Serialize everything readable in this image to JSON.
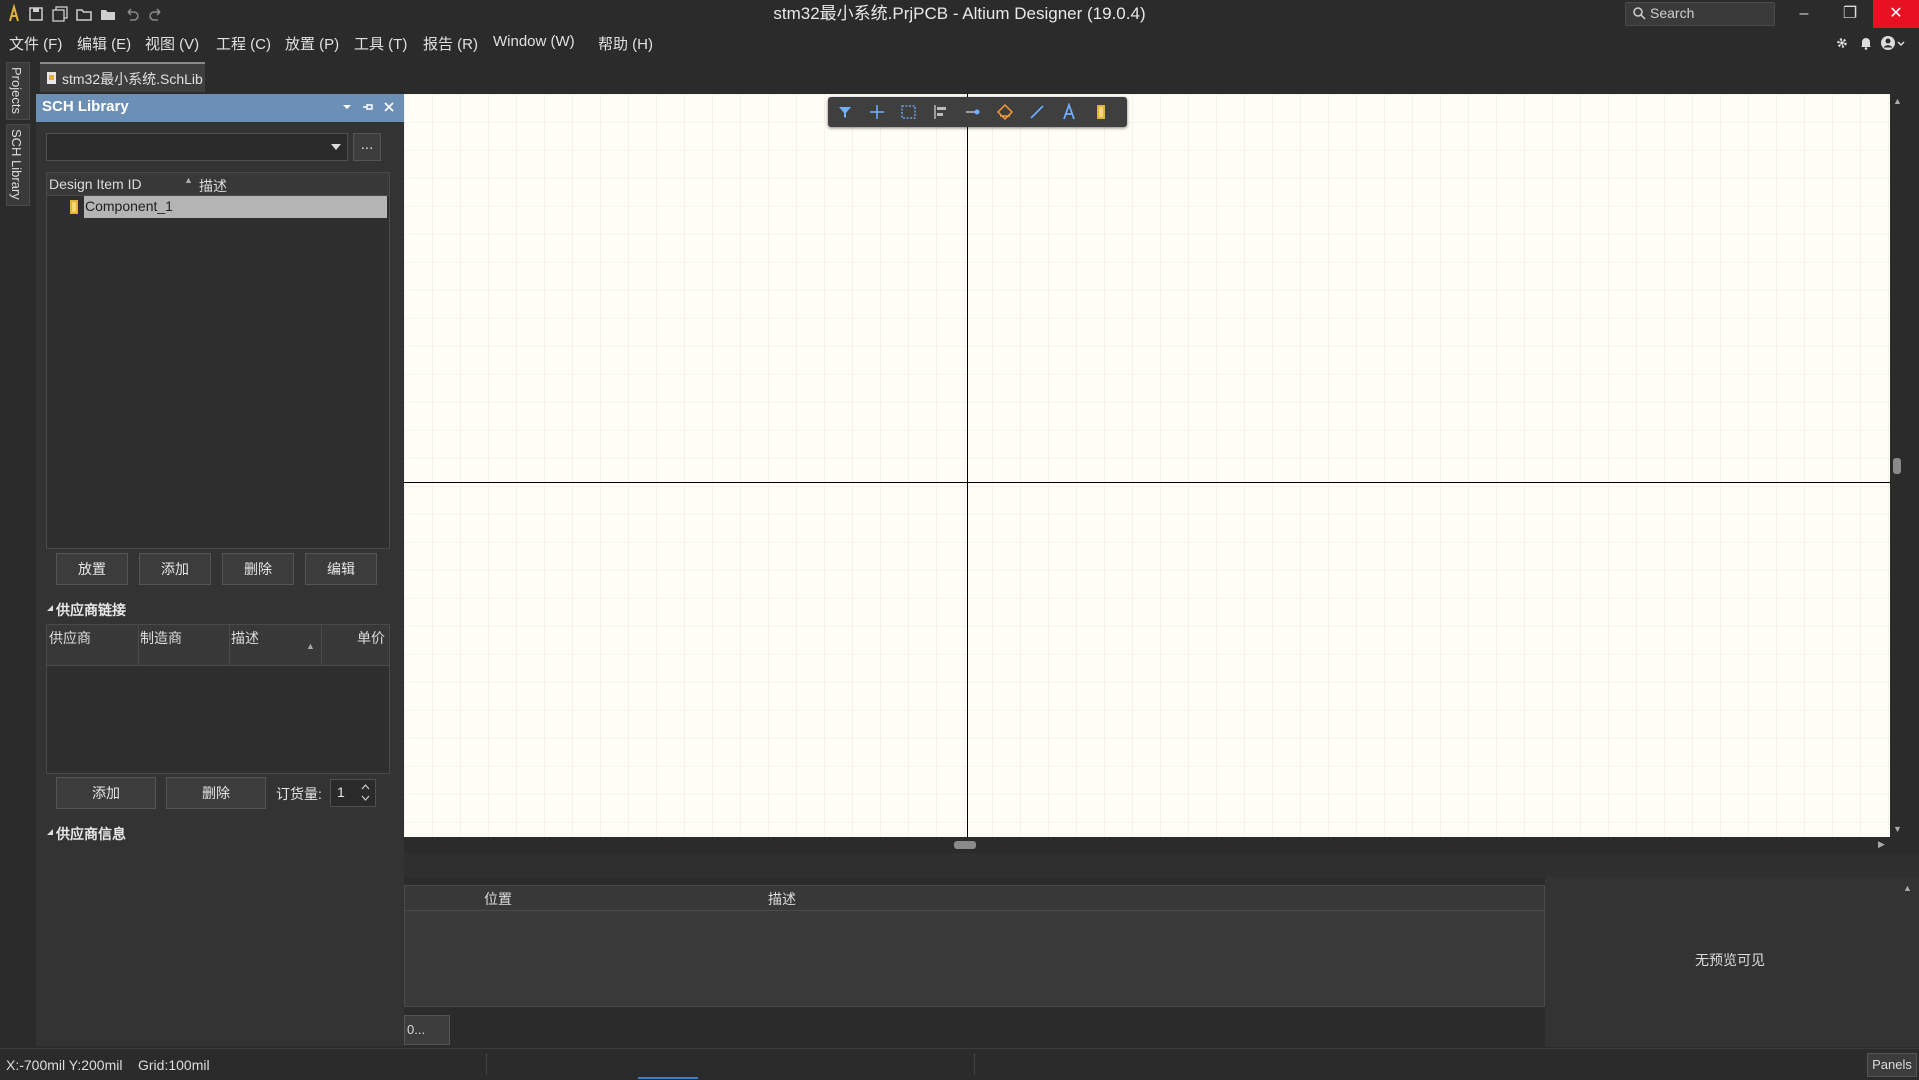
{
  "window": {
    "title": "stm32最小系统.PrjPCB - Altium Designer (19.0.4)",
    "search_placeholder": "Search",
    "min": "–",
    "restore": "❐",
    "close": "✕"
  },
  "menu": [
    "文件 (F)",
    "编辑 (E)",
    "视图 (V)",
    "工程 (C)",
    "放置 (P)",
    "工具 (T)",
    "报告 (R)",
    "Window (W)",
    "帮助 (H)"
  ],
  "doc_tab": "stm32最小系统.SchLib",
  "left_tabs": [
    "Projects",
    "SCH Library"
  ],
  "panel": {
    "title": "SCH Library",
    "browse": "...",
    "columns": [
      "Design Item ID",
      "描述"
    ],
    "items": [
      "Component_1"
    ],
    "buttons": [
      "放置",
      "添加",
      "删除",
      "编辑"
    ],
    "supplier_links": {
      "heading": "供应商链接",
      "columns": [
        "供应商",
        "制造商",
        "描述",
        "单价"
      ],
      "add": "添加",
      "delete": "删除",
      "qty_label": "订货量:",
      "qty_value": "1"
    },
    "supplier_info": {
      "heading": "供应商信息"
    }
  },
  "bottom": {
    "columns": [
      "位置",
      "描述"
    ],
    "no_preview": "无预览可见",
    "part_button": "0..."
  },
  "status": {
    "coords": "X:-700mil Y:200mil",
    "grid": "Grid:100mil",
    "panels": "Panels"
  },
  "colors": {
    "panel_header": "#6c8fb6",
    "canvas": "#fffdf6",
    "close_button": "#e81123"
  }
}
